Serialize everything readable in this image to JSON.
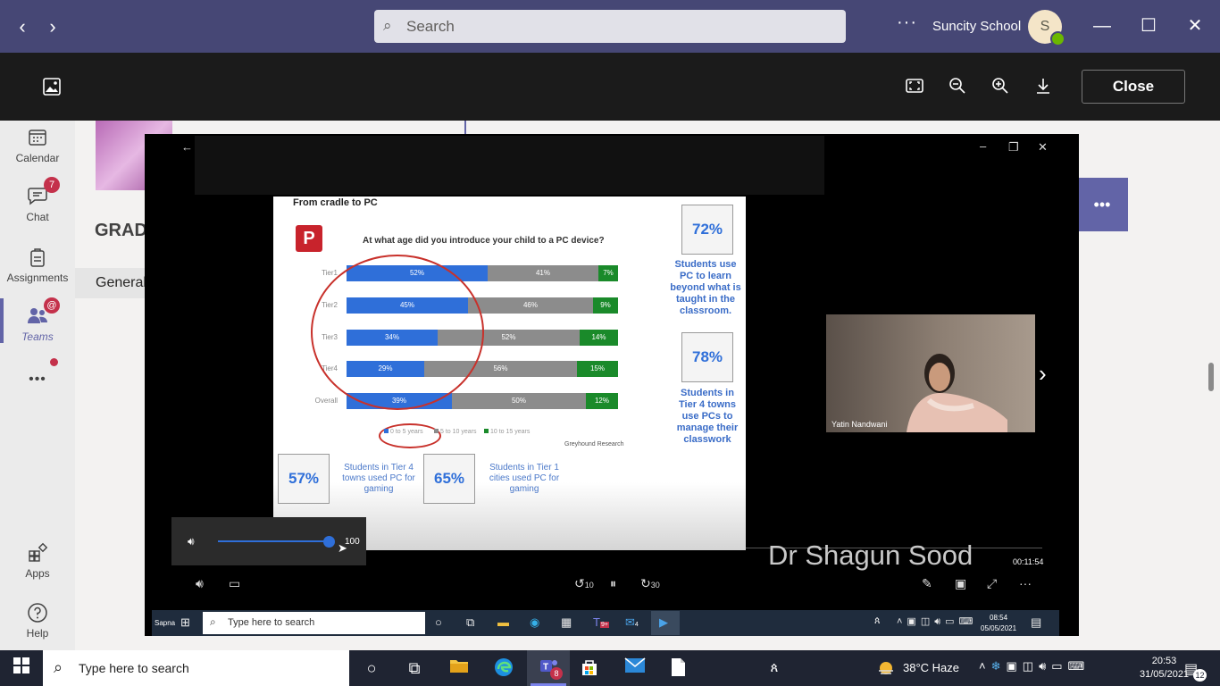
{
  "app": {
    "search_placeholder": "Search",
    "org_name": "Suncity School",
    "avatar_initial": "S",
    "viewer_close_label": "Close"
  },
  "rail": {
    "items": [
      {
        "label": "Calendar",
        "icon": "calendar-icon"
      },
      {
        "label": "Chat",
        "icon": "chat-icon",
        "badge": "7"
      },
      {
        "label": "Assignments",
        "icon": "assignments-icon"
      },
      {
        "label": "Teams",
        "icon": "teams-icon",
        "badge": "@"
      },
      {
        "label": "Apps",
        "icon": "apps-icon"
      },
      {
        "label": "Help",
        "icon": "help-icon"
      }
    ],
    "more": "•••"
  },
  "background": {
    "team_heading": "GRAD",
    "channel_tab": "General"
  },
  "slide": {
    "title": "From cradle to PC",
    "question": "At what age did you introduce your child to a PC device?",
    "rows": [
      {
        "label": "Tier1",
        "a": "52%",
        "b": "41%",
        "c": "7%"
      },
      {
        "label": "Tier2",
        "a": "45%",
        "b": "46%",
        "c": "9%"
      },
      {
        "label": "Tier3",
        "a": "34%",
        "b": "52%",
        "c": "14%"
      },
      {
        "label": "Tier4",
        "a": "29%",
        "b": "56%",
        "c": "15%"
      },
      {
        "label": "Overall",
        "a": "39%",
        "b": "50%",
        "c": "12%"
      }
    ],
    "legend": [
      "0 to 5 years",
      "5 to 10 years",
      "10 to 15 years"
    ],
    "source": "Greyhound Research",
    "stats": [
      {
        "value": "72%",
        "text": "Students use PC to learn beyond what is taught in the classroom."
      },
      {
        "value": "78%",
        "text": "Students in Tier 4 towns use PCs to manage their classwork"
      },
      {
        "value": "57%",
        "text": "Students in Tier 4 towns used PC for gaming"
      },
      {
        "value": "65%",
        "text": "Students in Tier 1 cities used PC for gaming"
      }
    ]
  },
  "video": {
    "participant_name": "Yatin Nandwani",
    "presenter": "Dr Shagun Sood",
    "timecode": "00:11:54",
    "volume": "100",
    "skip_back": "10",
    "skip_forward": "30"
  },
  "inner_taskbar": {
    "user": "Sapna",
    "search_placeholder": "Type here to search",
    "teams_badge": "9+",
    "mail_badge": "4",
    "time": "08:54",
    "date": "05/05/2021"
  },
  "taskbar": {
    "search_placeholder": "Type here to search",
    "teams_badge": "8",
    "weather": "38°C  Haze",
    "time": "20:53",
    "date": "31/05/2021",
    "notif_count": "12"
  }
}
